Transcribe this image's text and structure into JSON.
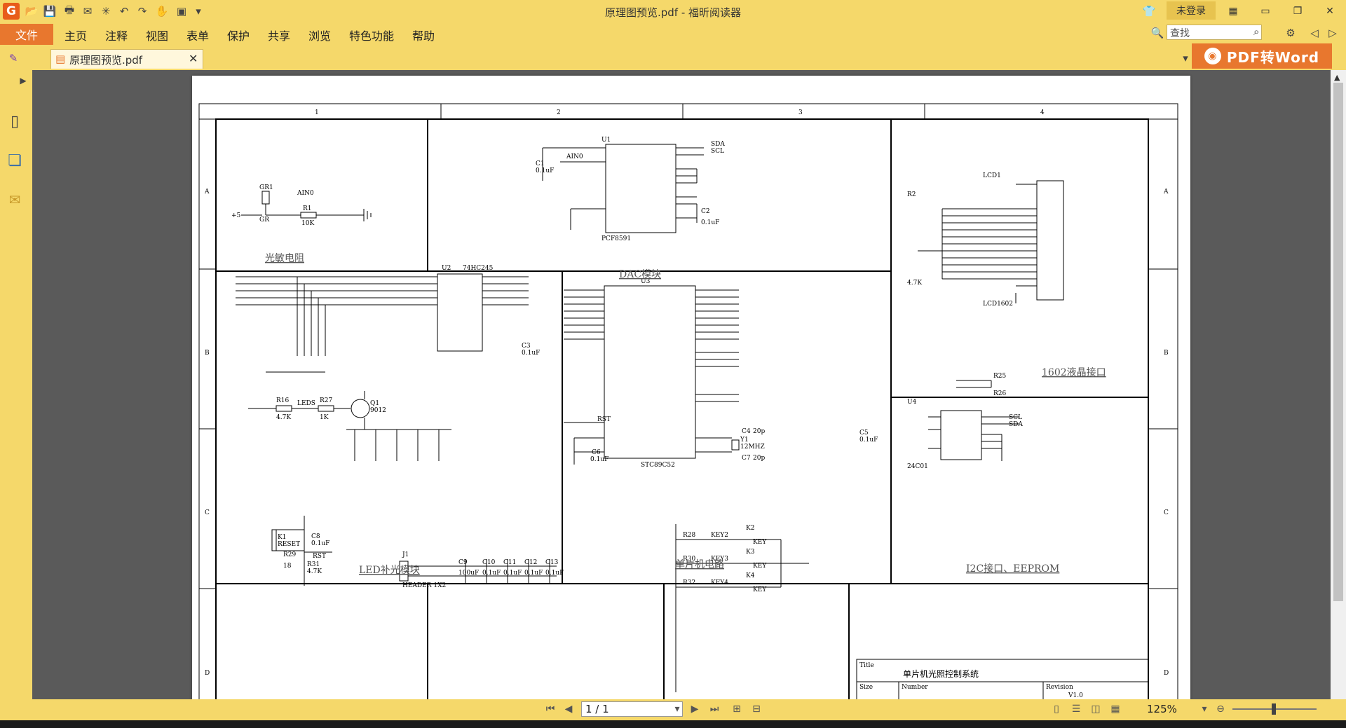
{
  "app": {
    "window_title": "原理图预览.pdf - 福昕阅读器",
    "login_label": "未登录",
    "logo_letter": "G"
  },
  "menu": {
    "file": "文件",
    "items": [
      "主页",
      "注释",
      "视图",
      "表单",
      "保护",
      "共享",
      "浏览",
      "特色功能",
      "帮助"
    ]
  },
  "search": {
    "placeholder": "查找"
  },
  "tab": {
    "filename": "原理图预览.pdf"
  },
  "promo": {
    "label": "PDF转Word"
  },
  "status": {
    "page_indicator": "1 / 1",
    "zoom": "125%"
  },
  "schematic": {
    "col_labels": [
      "1",
      "2",
      "3",
      "4"
    ],
    "row_labels": [
      "A",
      "B",
      "C",
      "D"
    ],
    "modules": {
      "photoresistor": "光敏电阻",
      "dac": "DAC模块",
      "lcd": "1602液晶接口",
      "led": "LED补光模块",
      "mcu": "单片机电路",
      "i2c": "I2C接口、EEPROM"
    },
    "title_block": {
      "title_label": "Title",
      "title": "单片机光照控制系统",
      "size_label": "Size",
      "number_label": "Number",
      "revision_label": "Revision",
      "revision": "V1.0"
    },
    "parts": {
      "gr1": "GR1",
      "gr": "GR",
      "ain0": "AIN0",
      "r1": "R1",
      "r1_val": "10K",
      "plus5": "+5",
      "u1": "U1",
      "pcf": "PCF8591",
      "c1": "C1",
      "c1_val": "0.1uF",
      "c2": "C2",
      "c2_val": "0.1uF",
      "u2": "U2",
      "hc245": "74HC245",
      "u3": "U3",
      "stc": "STC89C52",
      "lcd1": "LCD1",
      "lcd1602": "LCD1602",
      "r2": "R2",
      "r2_val": "4.7K",
      "u4": "U4",
      "eeprom": "24C01",
      "c5": "C5",
      "c5_val": "0.1uF",
      "y1": "Y1",
      "y1_val": "12MHZ",
      "c4": "C4",
      "c7": "C7",
      "c20p": "20p",
      "q1": "Q1",
      "q1_val": "9012",
      "r16": "R16",
      "r27": "R27",
      "r16_val": "4.7K",
      "r27_val": "1K",
      "leds": "LEDS",
      "j1": "J1",
      "header": "HEADER 1X2",
      "k1": "K1",
      "reset": "RESET",
      "rst": "RST",
      "r29": "R29",
      "r29_val": "18",
      "r31": "R31",
      "r31_val": "4.7K",
      "c8": "C8",
      "c8_val": "0.1uF",
      "c6": "C6",
      "c6_val": "0.1uF",
      "c3": "C3",
      "c3_val": "0.1uF",
      "c9": "C9",
      "c10": "C10",
      "c11": "C11",
      "c12": "C12",
      "c13": "C13",
      "c100": "100uF",
      "c01": "0.1uF",
      "r28": "R28",
      "r30": "R30",
      "r32": "R32",
      "k2": "K2",
      "k3": "K3",
      "k4": "K4",
      "key2": "KEY2",
      "key3": "KEY3",
      "key4": "KEY4",
      "key": "KEY",
      "r25": "R25",
      "r26": "R26",
      "scl": "SCL",
      "sda": "SDA"
    }
  }
}
